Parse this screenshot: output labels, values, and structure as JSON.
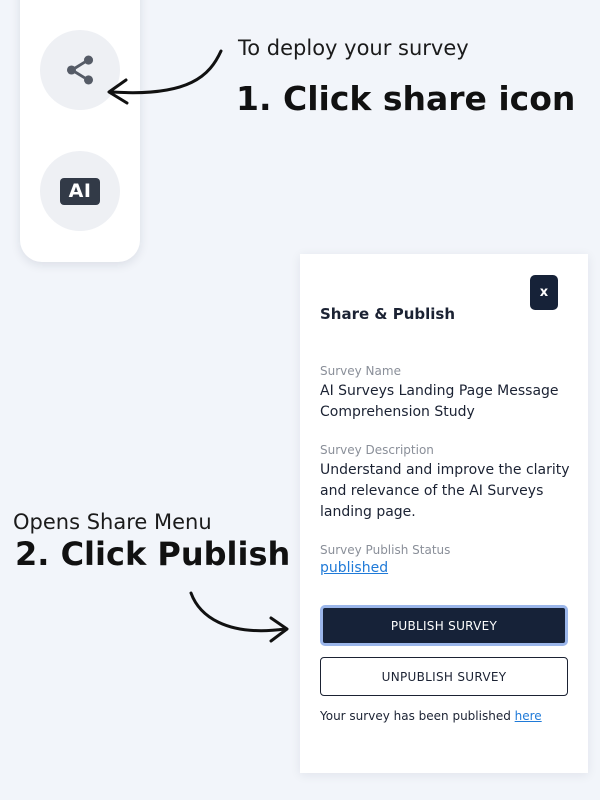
{
  "sidebar": {
    "share_icon": "share-icon",
    "ai_badge": "AI"
  },
  "annotations": {
    "step1_sub": "To deploy your survey",
    "step1_title": "1.  Click share icon",
    "step2_sub": "Opens Share Menu",
    "step2_title": "2. Click Publish"
  },
  "share_panel": {
    "close_label": "x",
    "title": "Share & Publish",
    "survey_name_label": "Survey Name",
    "survey_name": "AI Surveys Landing Page Message Comprehension Study",
    "survey_description_label": "Survey Description",
    "survey_description": "Understand and improve the clarity and relevance of the AI Surveys landing page.",
    "status_label": "Survey Publish Status",
    "status_value": "published",
    "publish_button": "PUBLISH SURVEY",
    "unpublish_button": "UNPUBLISH SURVEY",
    "footer_text": "Your survey has been published ",
    "footer_link": "here"
  },
  "colors": {
    "background": "#f2f5fa",
    "navy": "#162238",
    "link": "#1f7ad8",
    "focus_ring": "#9bb6ea"
  }
}
